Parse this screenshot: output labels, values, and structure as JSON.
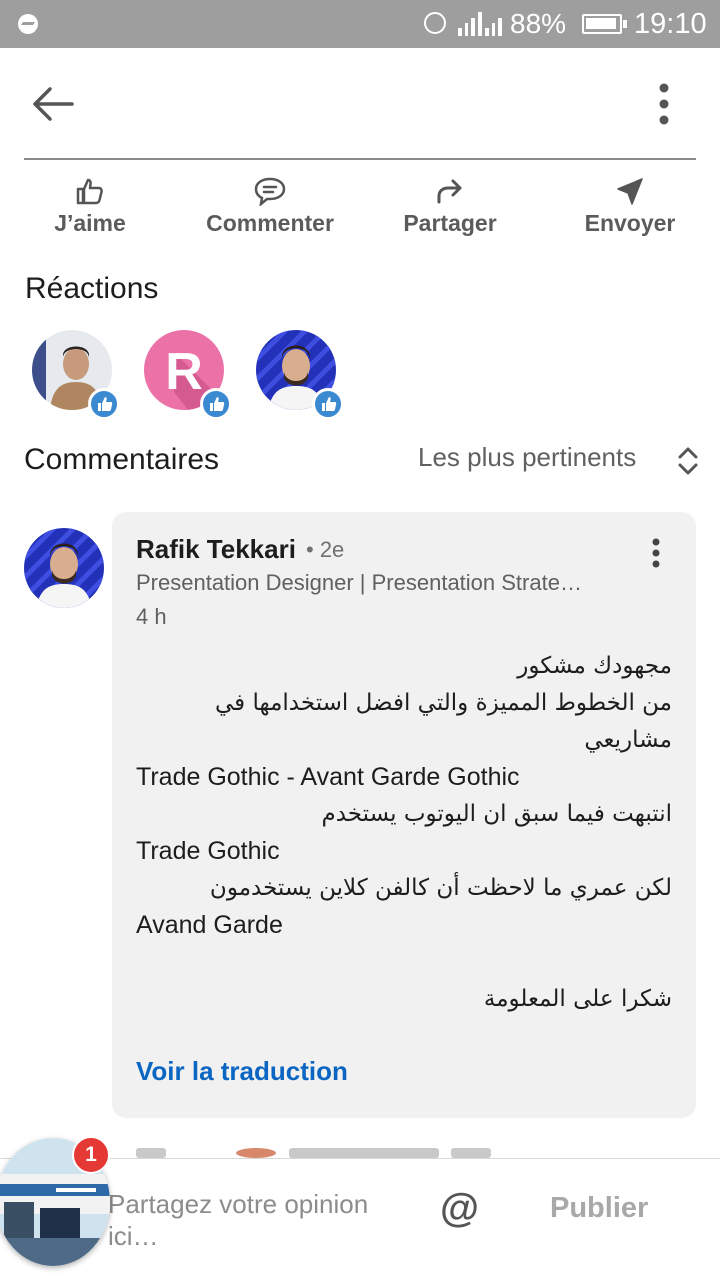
{
  "status_bar": {
    "battery": "88%",
    "time": "19:10"
  },
  "actions": {
    "like": "J’aime",
    "comment": "Commenter",
    "share": "Partager",
    "send": "Envoyer"
  },
  "reactions": {
    "title": "Réactions",
    "avatar_initial": "R"
  },
  "comments": {
    "title": "Commentaires",
    "sort_label": "Les plus pertinents",
    "items": [
      {
        "author": "Rafik Tekkari",
        "degree": "• 2e",
        "headline": "Presentation Designer | Presentation Strate…",
        "time": "4 h",
        "lines": [
          "مجهودك مشكور",
          "من الخطوط المميزة والتي افضل استخدامها في",
          "مشاريعي",
          "Trade Gothic - Avant Garde Gothic",
          "انتبهت فيما سبق ان اليوتوب يستخدم",
          "Trade Gothic",
          "لكن عمري ما لاحظت أن كالفن كلاين يستخدمون",
          "Avand Garde",
          "",
          "شكرا على المعلومة"
        ],
        "translate": "Voir la traduction"
      }
    ]
  },
  "composer": {
    "placeholder": "Partagez votre opinion ici…",
    "mention": "@",
    "publish": "Publier"
  },
  "chat_head": {
    "badge_count": "1"
  },
  "colors": {
    "link": "#0a66c2",
    "status_bar": "#9e9e9e",
    "reaction_badge": "#3a89d1",
    "notification": "#e53935"
  }
}
